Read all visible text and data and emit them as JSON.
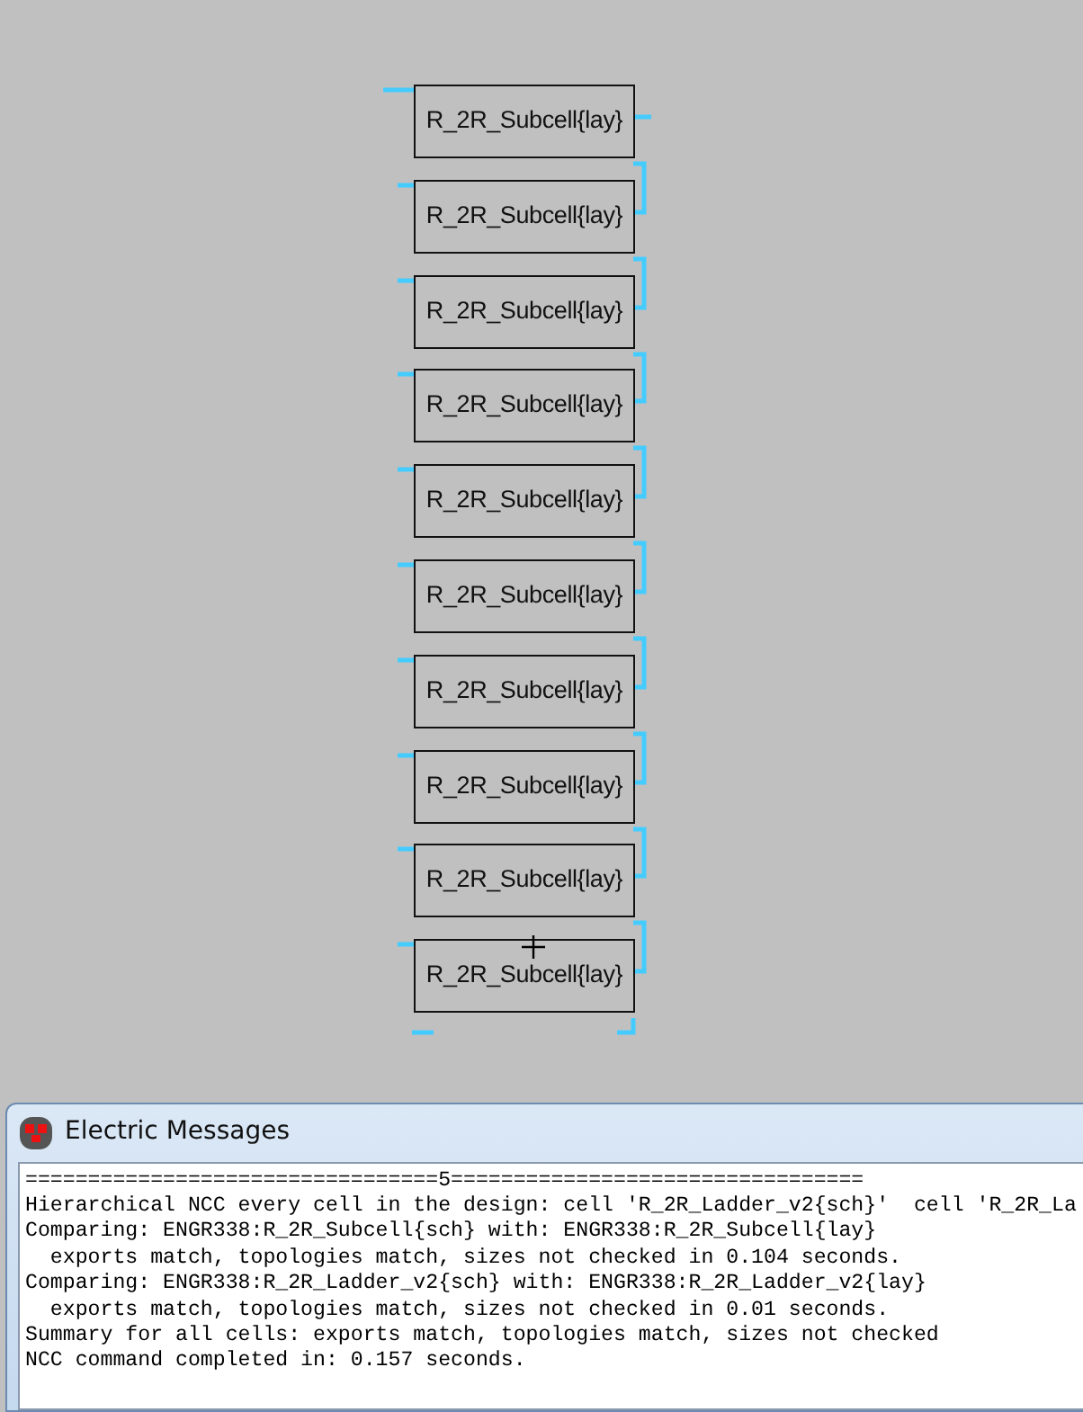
{
  "canvas": {
    "cells": [
      "R_2R_Subcell{lay}",
      "R_2R_Subcell{lay}",
      "R_2R_Subcell{lay}",
      "R_2R_Subcell{lay}",
      "R_2R_Subcell{lay}",
      "R_2R_Subcell{lay}",
      "R_2R_Subcell{lay}",
      "R_2R_Subcell{lay}",
      "R_2R_Subcell{lay}",
      "R_2R_Subcell{lay}"
    ]
  },
  "messages_window": {
    "title": "Electric Messages",
    "lines": [
      "=================================5=================================",
      "Hierarchical NCC every cell in the design: cell 'R_2R_Ladder_v2{sch}'  cell 'R_2R_La",
      "Comparing: ENGR338:R_2R_Subcell{sch} with: ENGR338:R_2R_Subcell{lay}",
      "  exports match, topologies match, sizes not checked in 0.104 seconds.",
      "Comparing: ENGR338:R_2R_Ladder_v2{sch} with: ENGR338:R_2R_Ladder_v2{lay}",
      "  exports match, topologies match, sizes not checked in 0.01 seconds.",
      "Summary for all cells: exports match, topologies match, sizes not checked",
      "NCC command completed in: 0.157 seconds."
    ]
  }
}
